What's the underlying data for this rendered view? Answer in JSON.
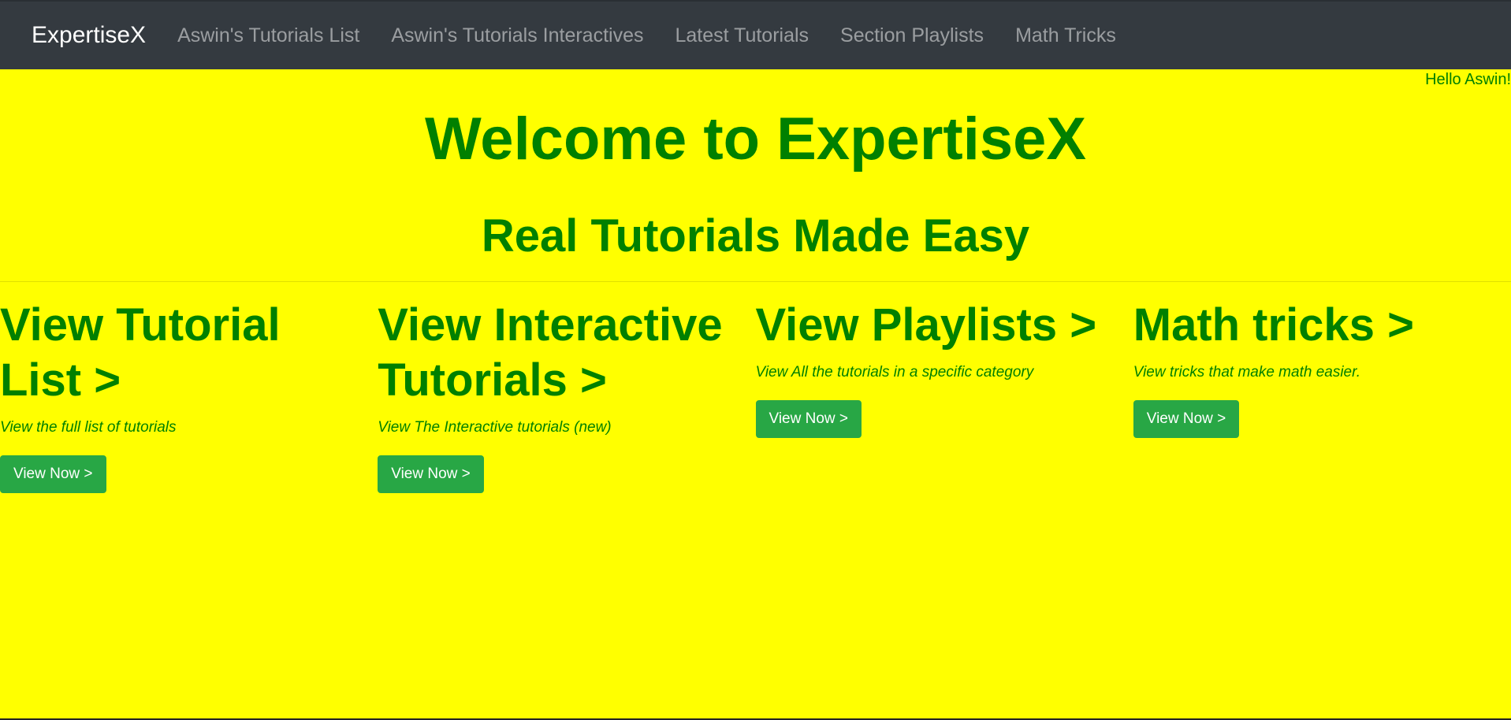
{
  "navbar": {
    "brand": "ExpertiseX",
    "links": [
      "Aswin's Tutorials List",
      "Aswin's Tutorials Interactives",
      "Latest Tutorials",
      "Section Playlists",
      "Math Tricks"
    ]
  },
  "greeting": "Hello Aswin!",
  "hero": {
    "title": "Welcome to ExpertiseX",
    "subtitle": "Real Tutorials Made Easy"
  },
  "cards": [
    {
      "title": "View Tutorial List >",
      "description": "View the full list of tutorials",
      "button": "View Now >"
    },
    {
      "title": "View Interactive Tutorials >",
      "description": "View The Interactive tutorials (new)",
      "button": "View Now >"
    },
    {
      "title": "View Playlists >",
      "description": "View All the tutorials in a specific category",
      "button": "View Now >"
    },
    {
      "title": "Math tricks >",
      "description": "View tricks that make math easier.",
      "button": "View Now >"
    }
  ],
  "colors": {
    "background": "#ffff00",
    "navbar": "#343a40",
    "text_green": "#008000",
    "button_green": "#28a745"
  }
}
